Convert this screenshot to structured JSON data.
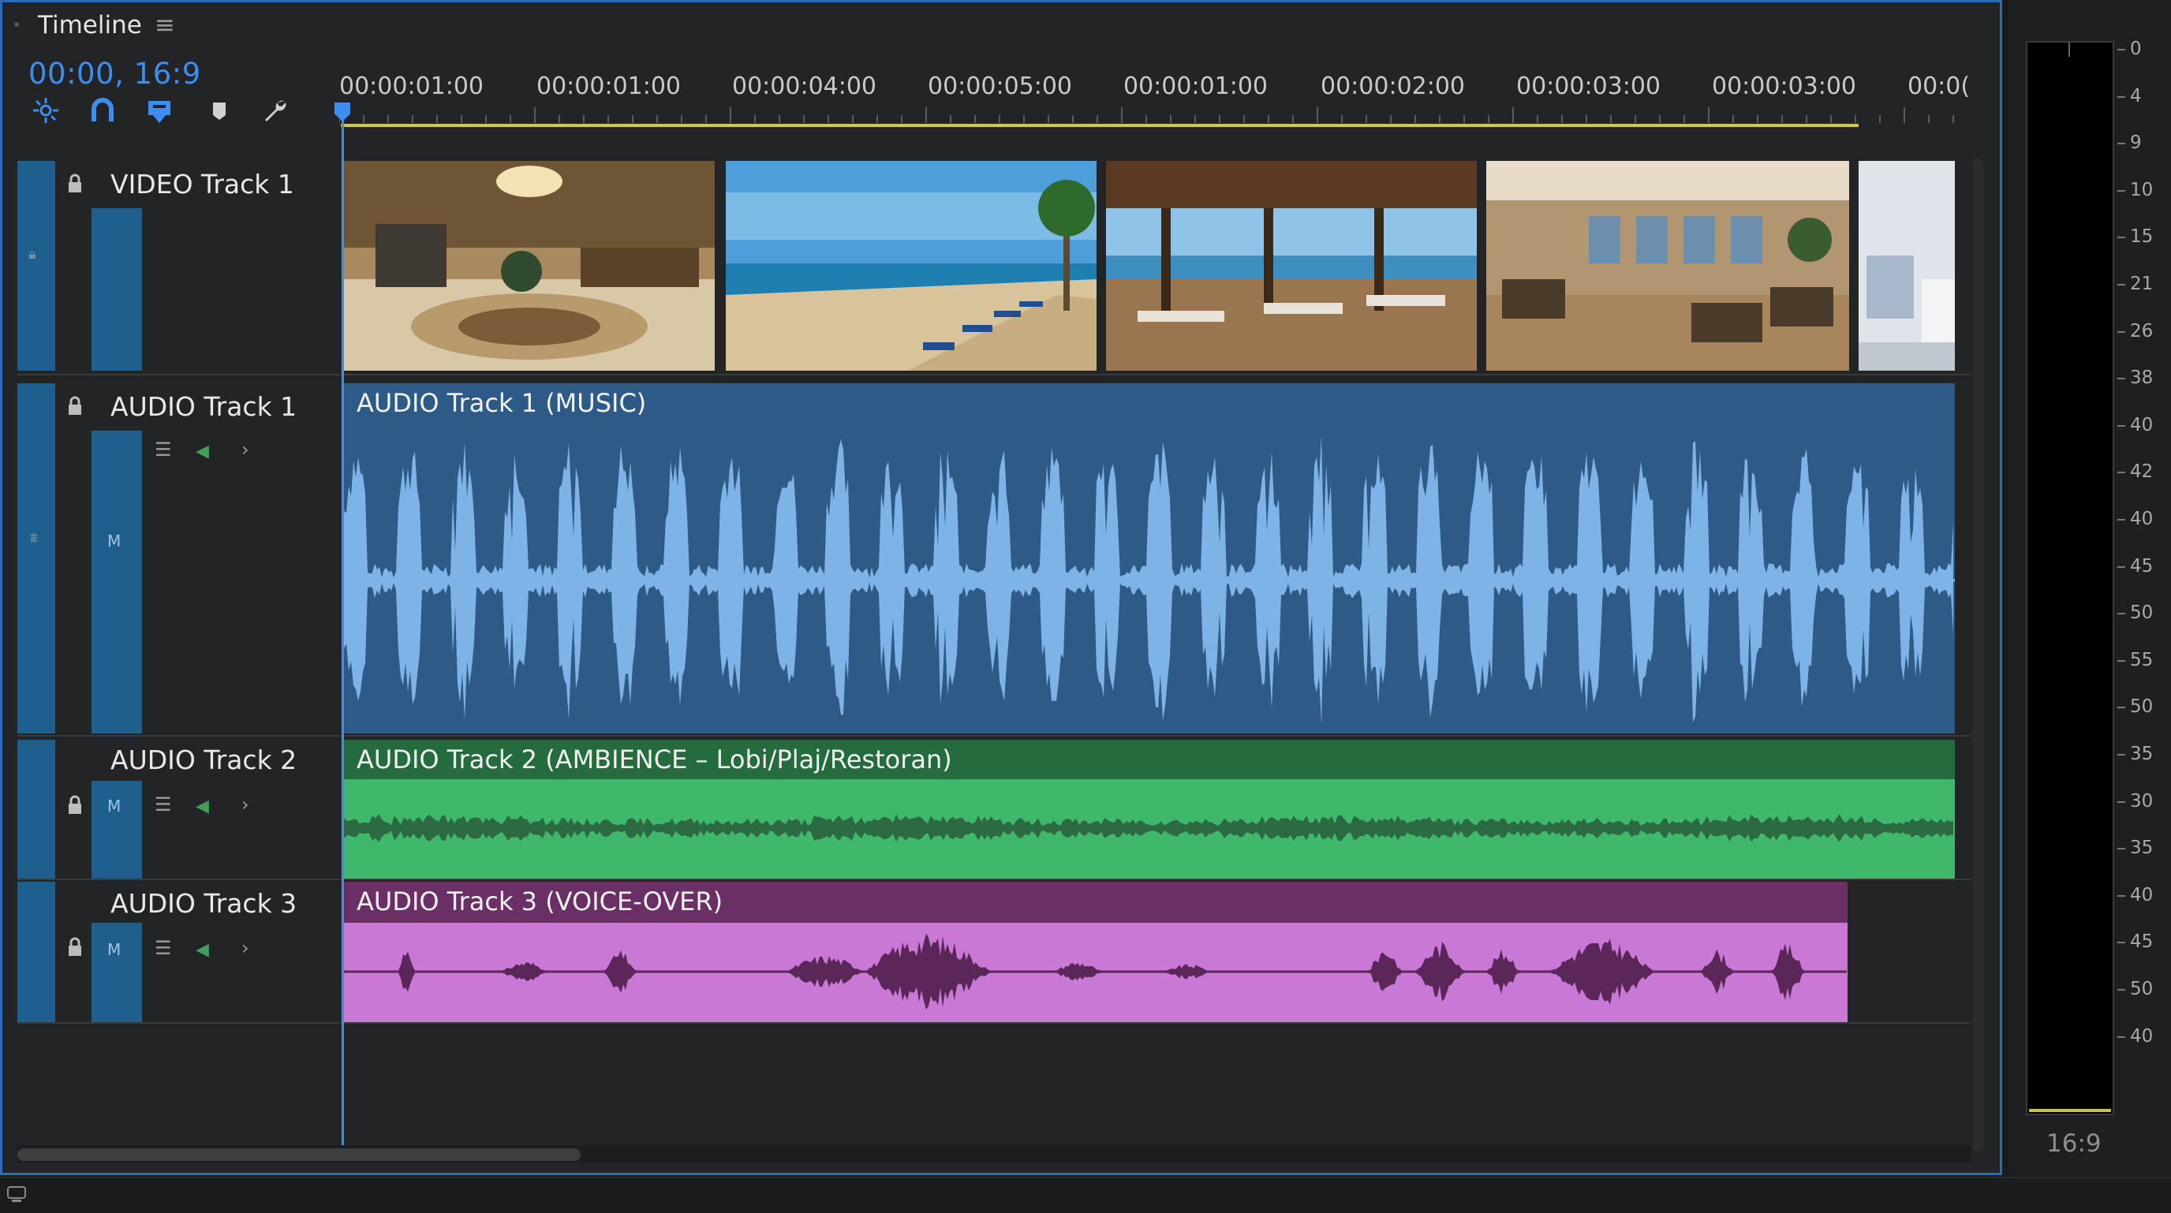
{
  "panel": {
    "title": "Timeline",
    "menu_icon": "hamburger-icon",
    "timecode": "00:00, 16:9",
    "tools": [
      "ripple-icon",
      "snap-magnet-icon",
      "linked-selection-icon",
      "marker-icon",
      "wrench-icon"
    ]
  },
  "ruler": {
    "labels": [
      "00:00:01:00",
      "00:00:01:00",
      "00:00:04:00",
      "00:00:05:00",
      "00:00:01:00",
      "00:00:02:00",
      "00:00:03:00",
      "00:00:03:00",
      "00:0("
    ]
  },
  "tracks": [
    {
      "name": "VIDEO Track 1",
      "type": "video"
    },
    {
      "name": "AUDIO Track 1",
      "type": "audio",
      "clip_label": "AUDIO Track 1 (MUSIC)",
      "color": "#2d5a86",
      "wave_color": "#7db3e6",
      "mute_label": "M"
    },
    {
      "name": "AUDIO Track 2",
      "type": "audio",
      "clip_label": "AUDIO Track 2 (AMBIENCE – Lobi/Plaj/Restoran)",
      "color": "#3fb86b",
      "header_color": "#246b3d",
      "wave_color": "#2c6a41",
      "mute_label": "M"
    },
    {
      "name": "AUDIO Track 3",
      "type": "audio",
      "clip_label": "AUDIO Track 3 (VOICE-OVER)",
      "color": "#c978d6",
      "header_color": "#6a3066",
      "wave_color": "#5a2758",
      "mute_label": "M"
    }
  ],
  "video_thumbnails": [
    "hotel-lobby",
    "beach-with-umbrellas",
    "terrace-restaurant",
    "indoor-restaurant",
    "hotel-room"
  ],
  "meter": {
    "db_labels": [
      "0",
      "4",
      "9",
      "10",
      "15",
      "21",
      "26",
      "38",
      "40",
      "42",
      "40",
      "45",
      "50",
      "55",
      "50",
      "35",
      "30",
      "35",
      "40",
      "45",
      "50",
      "40"
    ],
    "footer": "16:9",
    "level_color": "#c7c34a"
  }
}
